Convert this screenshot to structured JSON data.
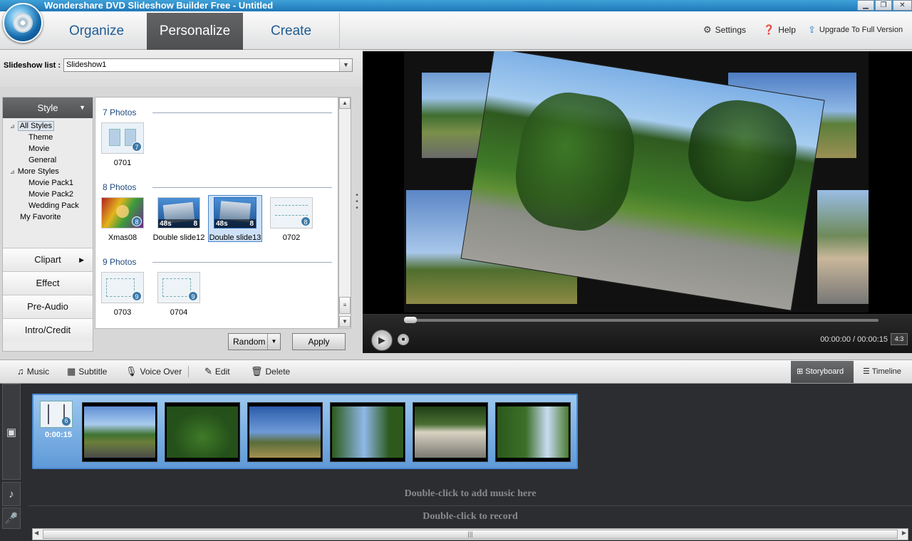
{
  "window": {
    "title": "Wondershare DVD Slideshow Builder Free - Untitled",
    "buttons": {
      "minimize": "▁",
      "restore": "❐",
      "close": "✕"
    }
  },
  "tabs": [
    {
      "label": "Organize",
      "active": false
    },
    {
      "label": "Personalize",
      "active": true
    },
    {
      "label": "Create",
      "active": false
    }
  ],
  "top_links": {
    "settings": "Settings",
    "help": "Help",
    "upgrade": "Upgrade To Full Version"
  },
  "slideshow": {
    "label": "Slideshow list :",
    "selected": "Slideshow1"
  },
  "style_panel": {
    "header": "Style",
    "tree": [
      {
        "label": "All Styles",
        "level": 0,
        "expander": "⊿",
        "selected": true
      },
      {
        "label": "Theme",
        "level": 1
      },
      {
        "label": "Movie",
        "level": 1
      },
      {
        "label": "General",
        "level": 1
      },
      {
        "label": "More Styles",
        "level": 0,
        "expander": "⊿"
      },
      {
        "label": "Movie Pack1",
        "level": 1
      },
      {
        "label": "Movie Pack2",
        "level": 1
      },
      {
        "label": "Wedding Pack",
        "level": 1
      },
      {
        "label": "My Favorite",
        "level": 0
      }
    ],
    "categories": [
      "Clipart",
      "Effect",
      "Pre-Audio",
      "Intro/Credit"
    ]
  },
  "gallery": {
    "groups": [
      {
        "title": "7 Photos",
        "items": [
          {
            "label": "0701",
            "badge": "7",
            "kind": "diagram"
          }
        ]
      },
      {
        "title": "8 Photos",
        "items": [
          {
            "label": "Xmas08",
            "badge": "8",
            "kind": "xmas"
          },
          {
            "label": "Double slide12",
            "badge": "8",
            "duration": "48s",
            "kind": "photo"
          },
          {
            "label": "Double slide13",
            "badge": "8",
            "duration": "48s",
            "kind": "photo",
            "selected": true
          },
          {
            "label": "0702",
            "badge": "8",
            "kind": "diagram"
          }
        ]
      },
      {
        "title": "9 Photos",
        "items": [
          {
            "label": "0703",
            "badge": "9",
            "kind": "diagram"
          },
          {
            "label": "0704",
            "badge": "9",
            "kind": "diagram"
          }
        ]
      }
    ],
    "random_label": "Random",
    "apply_label": "Apply"
  },
  "player": {
    "timecode": "00:00:00 / 00:00:15",
    "aspect": "4:3",
    "progress": 0
  },
  "edit_toolbar": {
    "music": "Music",
    "subtitle": "Subtitle",
    "voice_over": "Voice Over",
    "edit": "Edit",
    "delete": "Delete",
    "storyboard": "Storyboard",
    "timeline": "Timeline"
  },
  "storyboard": {
    "transition_duration": "0:00:15",
    "transition_badge": "6",
    "clip_count": 6
  },
  "tracks": {
    "music_hint": "Double-click to add music here",
    "record_hint": "Double-click to record"
  },
  "colors": {
    "title_blue": "#2283c4",
    "tab_active": "#58595b",
    "selection_blue": "#6aa6e0"
  }
}
